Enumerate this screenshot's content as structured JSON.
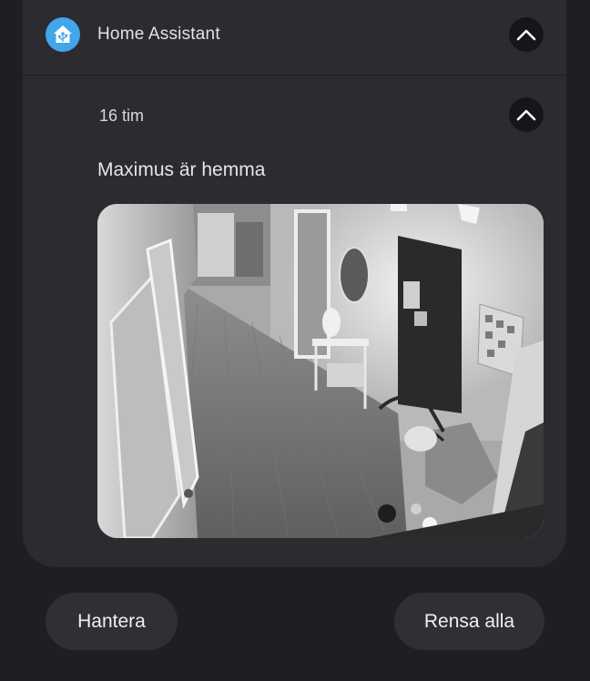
{
  "header": {
    "app_name": "Home Assistant",
    "app_icon": "home-assistant-icon",
    "collapse_icon": "chevron-up-icon"
  },
  "notification": {
    "time_ago": "16 tim",
    "message": "Maximus är hemma",
    "collapse_icon": "chevron-up-icon",
    "image": "camera-snapshot"
  },
  "actions": {
    "manage_label": "Hantera",
    "clear_all_label": "Rensa alla"
  },
  "colors": {
    "background": "#1f1f23",
    "card": "#2b2b30",
    "accent": "#41a6ea",
    "button": "#2f2f34"
  }
}
